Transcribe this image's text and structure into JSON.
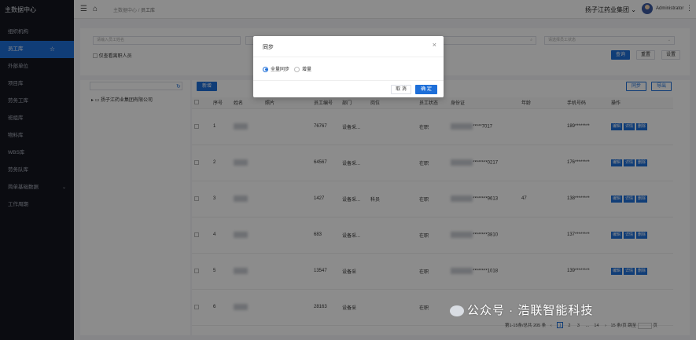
{
  "brand": "主数据中心",
  "sidebar": {
    "items": [
      {
        "label": "组织机构"
      },
      {
        "label": "员工库",
        "active": true
      },
      {
        "label": "外部单位"
      },
      {
        "label": "项目库"
      },
      {
        "label": "劳务工库"
      },
      {
        "label": "班组库"
      },
      {
        "label": "物料库"
      },
      {
        "label": "WBS库"
      },
      {
        "label": "劳务队库"
      },
      {
        "label": "简单基础数据",
        "expandable": true
      },
      {
        "label": "工作周期"
      }
    ]
  },
  "header": {
    "breadcrumb": [
      "主数据中心",
      "员工库"
    ],
    "org": "扬子江药业集团",
    "user": "Administrator"
  },
  "filters": {
    "keyword_placeholder": "请输入员工姓名",
    "status_placeholder": "请选择员工状态",
    "checkbox_label": "仅查看离职人员",
    "search_btn": "查询",
    "reset_btn": "重置",
    "settings_btn": "设置"
  },
  "tree": {
    "search_value": "",
    "root": "扬子江药业集团有限公司"
  },
  "toolbar": {
    "add": "新增",
    "sync": "同步",
    "export": "导出"
  },
  "table": {
    "columns": [
      "序号",
      "姓名",
      "照片",
      "员工编号",
      "部门",
      "岗位",
      "员工状态",
      "身份证",
      "年龄",
      "手机号码",
      "操作"
    ],
    "rows": [
      {
        "no": "1",
        "code": "76767",
        "dept": "设备采...",
        "post": "",
        "status": "在职",
        "id": "*****7017",
        "age": "",
        "phone": "189********"
      },
      {
        "no": "2",
        "code": "64567",
        "dept": "设备采...",
        "post": "",
        "status": "在职",
        "id": "********0217",
        "age": "",
        "phone": "176********"
      },
      {
        "no": "3",
        "code": "1427",
        "dept": "设备采...",
        "post": "科员",
        "status": "在职",
        "id": "********9613",
        "age": "47",
        "phone": "138********"
      },
      {
        "no": "4",
        "code": "683",
        "dept": "设备采...",
        "post": "",
        "status": "在职",
        "id": "********3810",
        "age": "",
        "phone": "137********"
      },
      {
        "no": "5",
        "code": "13547",
        "dept": "设备采",
        "post": "",
        "status": "在职",
        "id": "********1018",
        "age": "",
        "phone": "139********"
      },
      {
        "no": "6",
        "code": "28163",
        "dept": "设备采",
        "post": "",
        "status": "在职",
        "id": "",
        "age": "",
        "phone": ""
      }
    ],
    "ops": [
      "编辑",
      "详情",
      "删除"
    ]
  },
  "pager": {
    "summary": "第1-15条/总共 205 条",
    "pages": [
      "1",
      "2",
      "3",
      "...",
      "14"
    ],
    "page_size": "15 条/页",
    "jump": "跳至",
    "page_unit": "页"
  },
  "modal": {
    "title": "同步",
    "options": [
      "全量同步",
      "增量"
    ],
    "selected": 0,
    "cancel": "取 消",
    "ok": "确 定"
  },
  "watermark": "公众号 · 浩联智能科技"
}
